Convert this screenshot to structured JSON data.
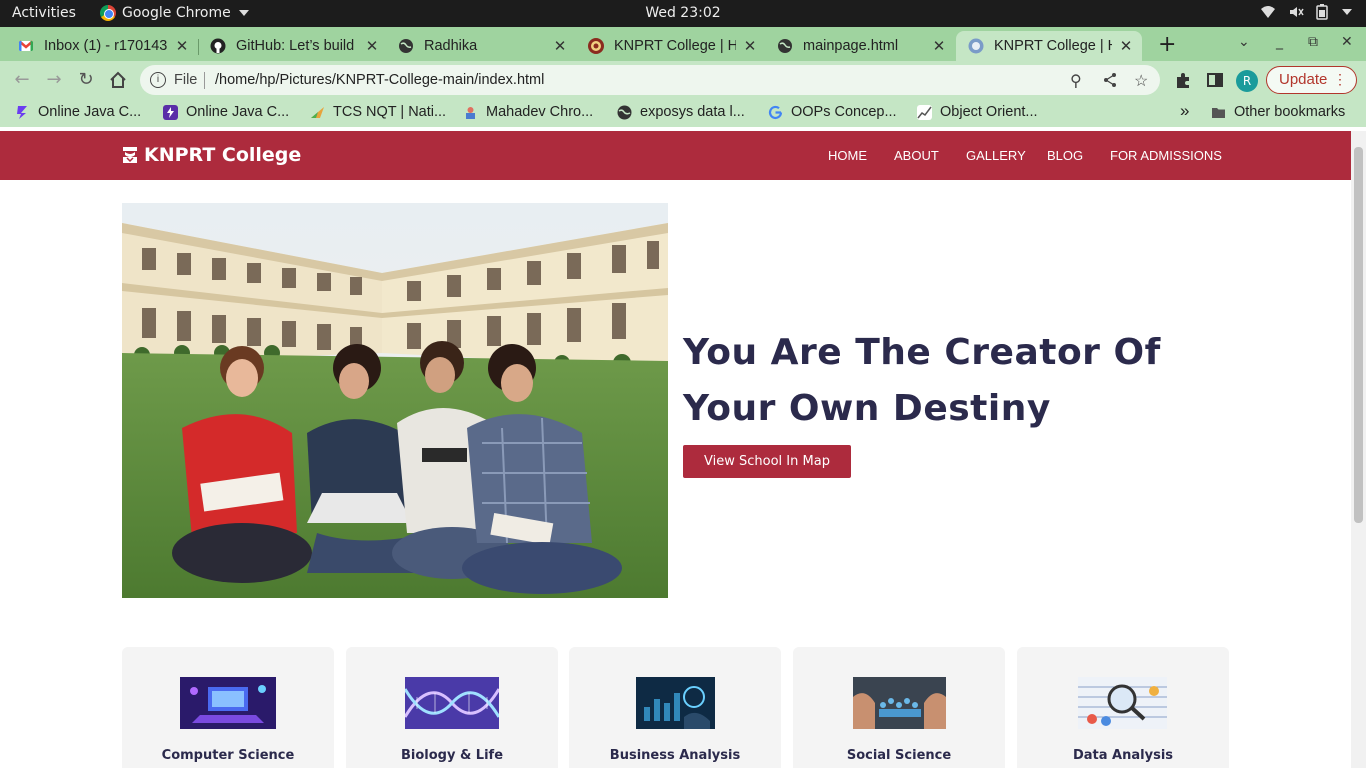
{
  "os": {
    "activities": "Activities",
    "app_name": "Google Chrome",
    "clock": "Wed 23:02"
  },
  "tabs": [
    {
      "title": "Inbox (1) - r170143",
      "favicon": "gmail-icon"
    },
    {
      "title": "GitHub: Let’s build",
      "favicon": "github-icon"
    },
    {
      "title": "Radhika",
      "favicon": "globe-icon"
    },
    {
      "title": "KNPRT College | H",
      "favicon": "college-icon"
    },
    {
      "title": "mainpage.html",
      "favicon": "globe-icon"
    },
    {
      "title": "KNPRT College | H",
      "favicon": "college-icon",
      "active": true
    }
  ],
  "address_bar": {
    "scheme": "File",
    "url": "/home/hp/Pictures/KNPRT-College-main/index.html"
  },
  "profile_initial": "R",
  "update_label": "Update",
  "bookmarks": [
    {
      "label": "Online Java C...",
      "color": "#6b3df0"
    },
    {
      "label": "Online Java C...",
      "color": "#5a2ea8"
    },
    {
      "label": "TCS NQT | Nati...",
      "color": "#e8a33c"
    },
    {
      "label": "Mahadev Chro...",
      "color": "#e07060"
    },
    {
      "label": "exposys data l...",
      "color": "#333333"
    },
    {
      "label": "OOPs Concep...",
      "color": "#4285f4"
    },
    {
      "label": "Object Orient...",
      "color": "#666666"
    }
  ],
  "bookmarks_overflow": "»",
  "other_bookmarks": "Other bookmarks",
  "site": {
    "brand": "KNPRT College",
    "accent": "#ad2b3d",
    "nav": [
      "HOME",
      "ABOUT",
      "GALLERY",
      "BLOG",
      "FOR ADMISSIONS"
    ],
    "hero_title": "You Are The Creator Of Your Own Destiny",
    "hero_button": "View School In Map",
    "courses": [
      {
        "name": "Computer Science",
        "icon": "computer-science-image"
      },
      {
        "name": "Biology & Life",
        "icon": "biology-image"
      },
      {
        "name": "Business Analysis",
        "icon": "business-image"
      },
      {
        "name": "Social Science",
        "icon": "social-science-image"
      },
      {
        "name": "Data Analysis",
        "icon": "data-analysis-image"
      }
    ]
  }
}
